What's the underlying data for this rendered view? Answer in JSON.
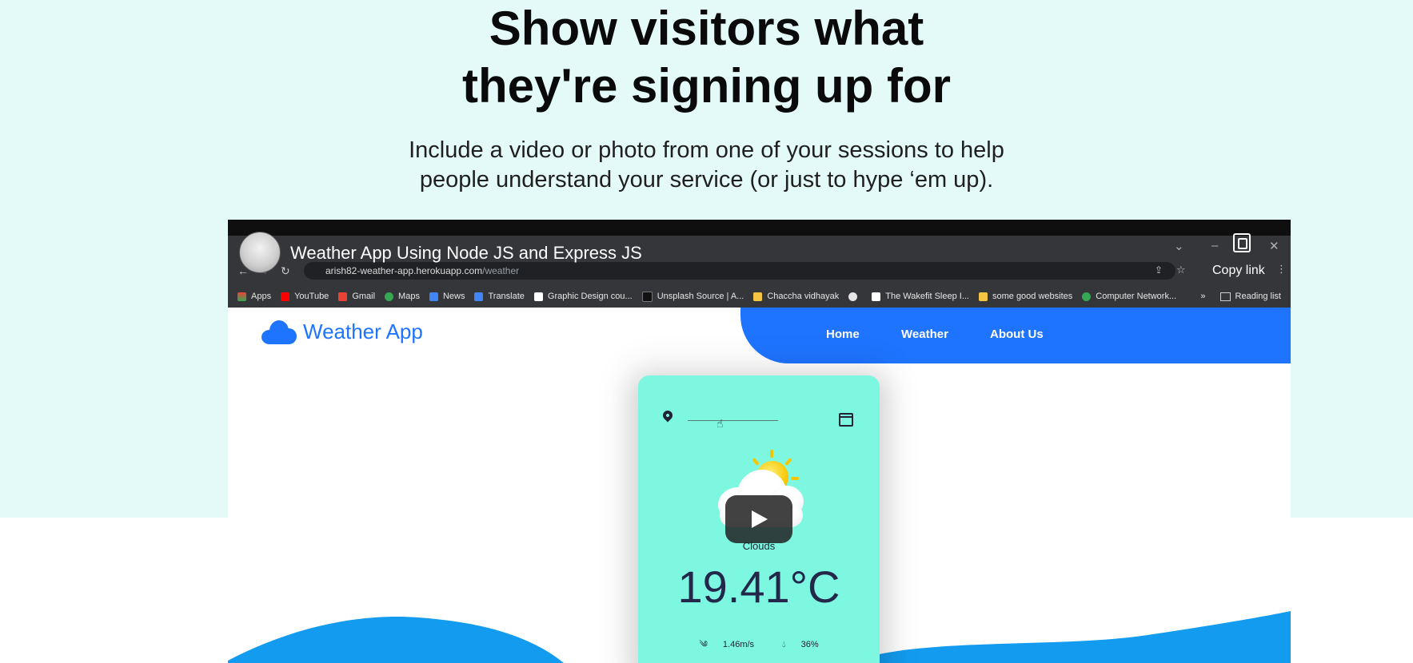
{
  "hero": {
    "headline_line1": "Show visitors what",
    "headline_line2": "they're signing up for",
    "subtext_line1": "Include a video or photo from one of your sessions to help",
    "subtext_line2": "people understand your service (or just to hype ‘em up)."
  },
  "video": {
    "title": "Weather App Using Node JS and Express JS",
    "copy_link_label": "Copy link",
    "play_label": "Play",
    "browser": {
      "url_host": "arish82-weather-app.herokuapp.com",
      "url_path": "/weather",
      "bookmarks": [
        "Apps",
        "YouTube",
        "Gmail",
        "Maps",
        "News",
        "Translate",
        "Graphic Design cou...",
        "Unsplash Source | A...",
        "Chaccha vidhayak",
        "The Wakefit Sleep I...",
        "some good websites",
        "Computer Network..."
      ],
      "more_bookmarks": "»",
      "reading_list": "Reading list"
    },
    "site": {
      "logo_text": "Weather App",
      "nav": [
        "Home",
        "Weather",
        "About Us"
      ],
      "card": {
        "condition": "Clouds",
        "temperature": "19.41°C",
        "wind": "1.46m/s",
        "humidity": "36%"
      }
    }
  },
  "colors": {
    "hero_bg": "#e3faf8",
    "brand_blue": "#1e74ff",
    "card_bg": "#7ef7e1",
    "wave_blue": "#139cef"
  }
}
